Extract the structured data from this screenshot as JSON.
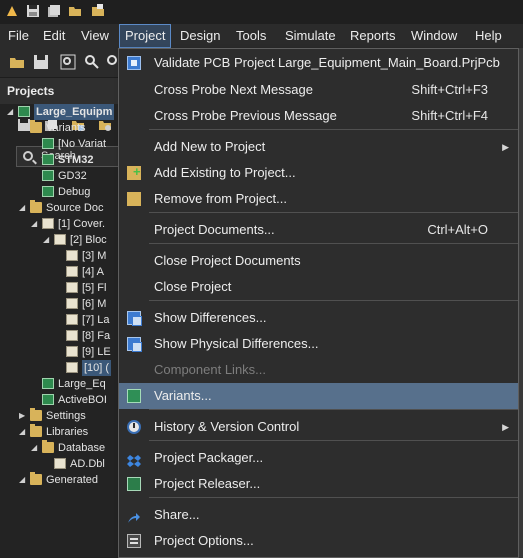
{
  "menubar": {
    "items": [
      "File",
      "Edit",
      "View",
      "Project",
      "Design",
      "Tools",
      "Simulate",
      "Reports",
      "Window",
      "Help"
    ],
    "active": "Project"
  },
  "panel": {
    "title": "Projects",
    "search_placeholder": "Search"
  },
  "tree": [
    {
      "label": "Large_Equipm",
      "icon": "pcb-project-icon",
      "bold": true,
      "selected": true
    },
    {
      "label": "Variants",
      "icon": "folder-icon"
    },
    {
      "label": "[No Variat",
      "icon": "variant-icon"
    },
    {
      "label": "STM32",
      "icon": "variant-icon",
      "bold": true
    },
    {
      "label": "GD32",
      "icon": "variant-icon"
    },
    {
      "label": "Debug",
      "icon": "variant-icon"
    },
    {
      "label": "Source Doc",
      "icon": "folder-icon"
    },
    {
      "label": "[1] Cover.",
      "icon": "schematic-icon"
    },
    {
      "label": "[2] Bloc",
      "icon": "schematic-icon"
    },
    {
      "label": "[3] M",
      "icon": "schematic-icon"
    },
    {
      "label": "[4] A",
      "icon": "schematic-icon"
    },
    {
      "label": "[5] Fl",
      "icon": "schematic-icon"
    },
    {
      "label": "[6] M",
      "icon": "schematic-icon"
    },
    {
      "label": "[7] La",
      "icon": "schematic-icon"
    },
    {
      "label": "[8] Fa",
      "icon": "schematic-icon"
    },
    {
      "label": "[9] LE",
      "icon": "schematic-icon"
    },
    {
      "label": "[10] (",
      "icon": "schematic-icon",
      "selected": true
    },
    {
      "label": "Large_Eq",
      "icon": "pcb-icon"
    },
    {
      "label": "ActiveBOI",
      "icon": "bom-icon"
    },
    {
      "label": "Settings",
      "icon": "folder-icon"
    },
    {
      "label": "Libraries",
      "icon": "folder-icon"
    },
    {
      "label": "Database",
      "icon": "folder-icon"
    },
    {
      "label": "AD.Dbl",
      "icon": "database-icon"
    },
    {
      "label": "Generated",
      "icon": "folder-icon"
    }
  ],
  "dropdown": {
    "items": [
      {
        "label": "Validate PCB Project Large_Equipment_Main_Board.PrjPcb",
        "icon": "validate-icon"
      },
      {
        "label": "Cross Probe Next Message",
        "shortcut": "Shift+Ctrl+F3"
      },
      {
        "label": "Cross Probe Previous Message",
        "shortcut": "Shift+Ctrl+F4"
      },
      {
        "label": "Add New to Project",
        "submenu": true
      },
      {
        "label": "Add Existing to Project...",
        "icon": "add-existing-icon"
      },
      {
        "label": "Remove from Project...",
        "icon": "remove-icon"
      },
      {
        "label": "Project Documents...",
        "shortcut": "Ctrl+Alt+O"
      },
      {
        "label": "Close Project Documents"
      },
      {
        "label": "Close Project"
      },
      {
        "label": "Show Differences...",
        "icon": "differences-icon"
      },
      {
        "label": "Show Physical Differences...",
        "icon": "physical-differences-icon"
      },
      {
        "label": "Component Links...",
        "disabled": true
      },
      {
        "label": "Variants...",
        "icon": "variants-icon",
        "highlighted": true
      },
      {
        "label": "History & Version Control",
        "icon": "history-icon",
        "submenu": true
      },
      {
        "label": "Project Packager...",
        "icon": "packager-icon"
      },
      {
        "label": "Project Releaser...",
        "icon": "releaser-icon"
      },
      {
        "label": "Share...",
        "icon": "share-icon"
      },
      {
        "label": "Project Options...",
        "icon": "options-icon"
      }
    ]
  },
  "colors": {
    "menu_background": "#2d2d2d",
    "highlight": "#57708c",
    "active_menu_border": "#5b8ac7",
    "panel_background": "#232323"
  }
}
